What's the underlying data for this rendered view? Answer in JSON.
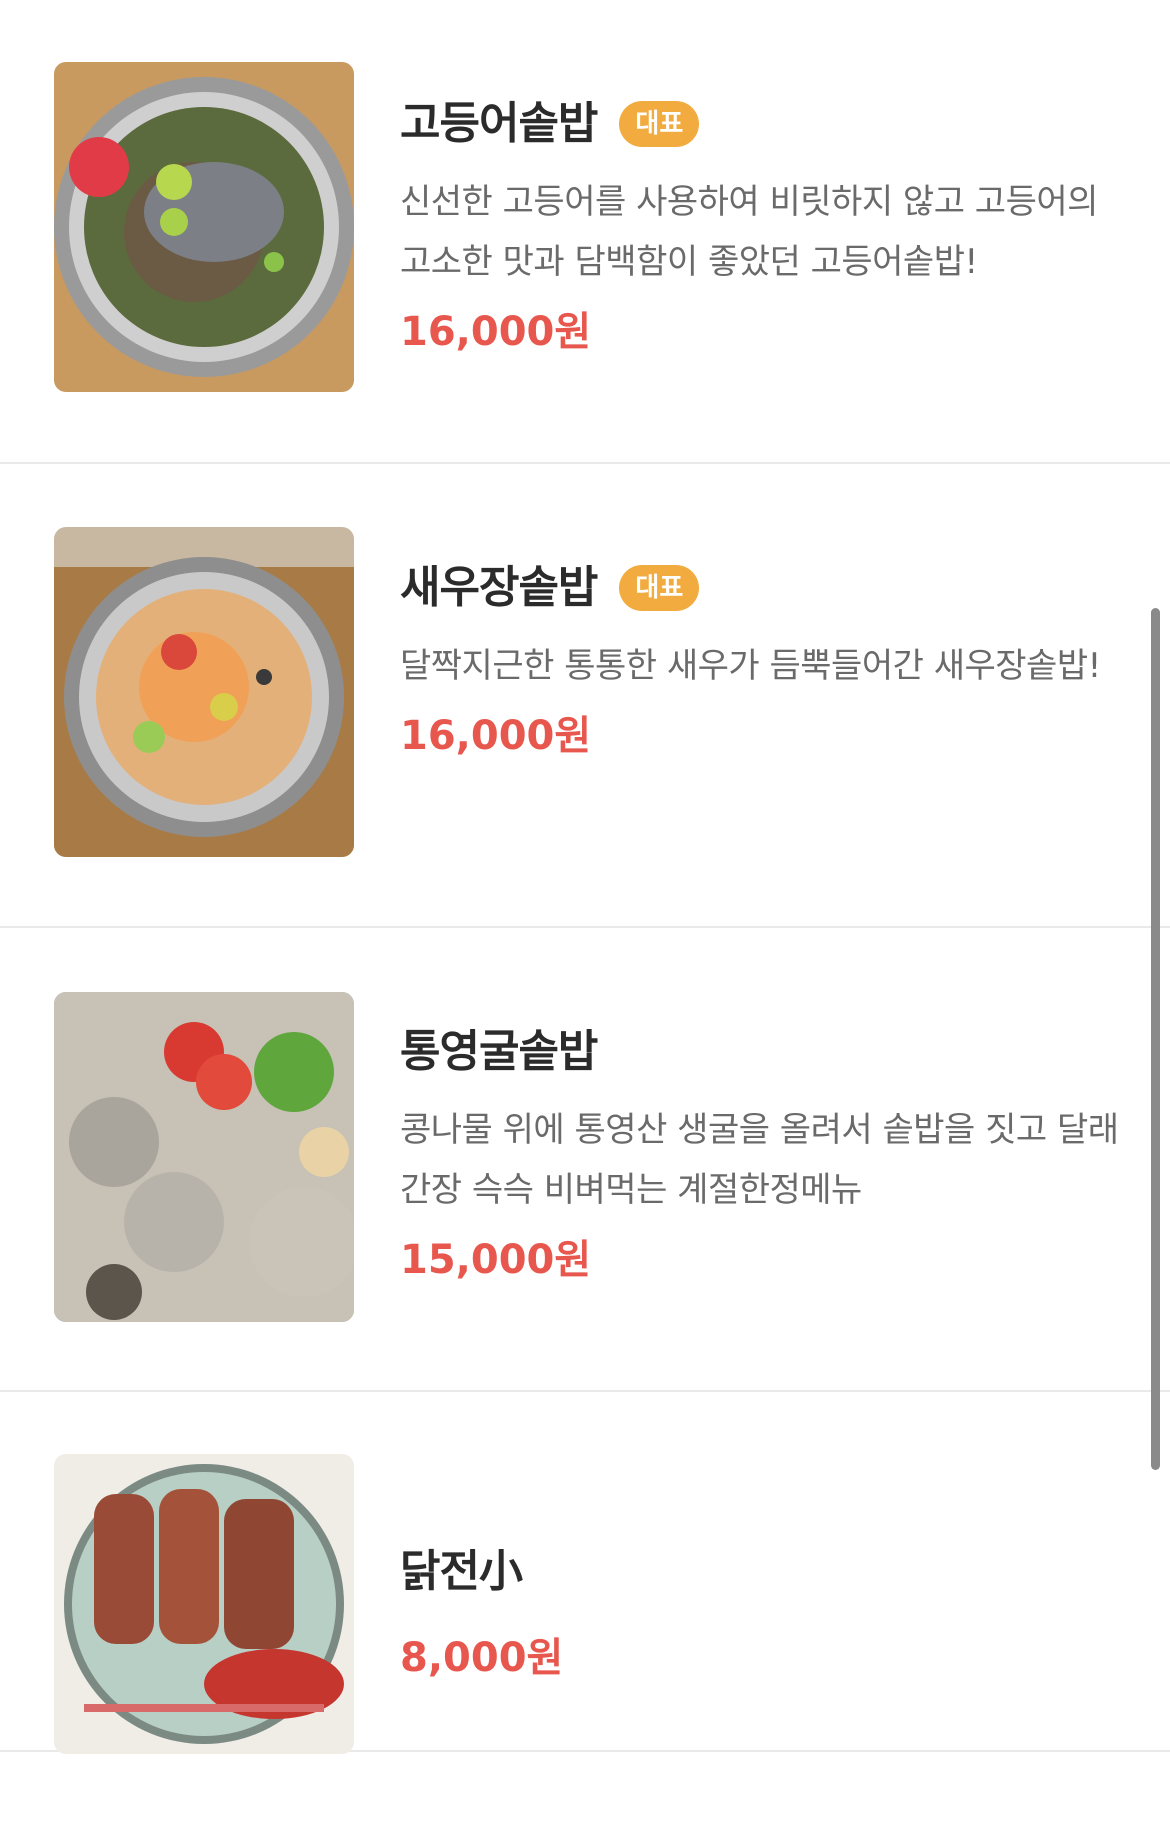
{
  "menu": {
    "items": [
      {
        "name": "고등어솥밥",
        "badge": "대표",
        "description": "신선한 고등어를 사용하여 비릿하지 않고 고등어의 고소한 맛과 담백함이 좋았던 고등어솥밥!",
        "price": "16,000원",
        "image": "mackerel-sotbap-photo"
      },
      {
        "name": "새우장솥밥",
        "badge": "대표",
        "description": "달짝지근한 통통한 새우가 듬뿍들어간 새우장솥밥!",
        "price": "16,000원",
        "image": "shrimp-sotbap-photo"
      },
      {
        "name": "통영굴솥밥",
        "description": "콩나물 위에 통영산 생굴을 올려서 솥밥을 짓고 달래간장 슥슥 비벼먹는 계절한정메뉴",
        "price": "15,000원",
        "image": "oyster-sotbap-photo"
      },
      {
        "name": "닭전小",
        "price": "8,000원",
        "image": "chicken-jeon-photo"
      }
    ]
  },
  "colors": {
    "badge": "#f2ab3f",
    "price": "#e8574e",
    "title": "#2b2b2b",
    "description": "#6a6a6a"
  }
}
